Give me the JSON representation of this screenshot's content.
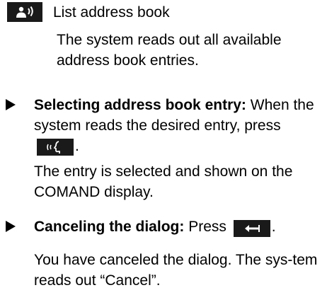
{
  "command": {
    "icon": "voice-command-person-icon",
    "label": "List address book",
    "description": "The system reads out all available address book entries."
  },
  "steps": [
    {
      "title": "Selecting address book entry:",
      "text_before": "When the system reads the desired entry, press",
      "icon": "talk-button-icon",
      "text_after": ".",
      "result": "The entry is selected and shown on the COMAND display."
    },
    {
      "title": "Canceling the dialog:",
      "text_before": "Press",
      "icon": "back-button-icon",
      "text_after": ".",
      "result": "You have canceled the dialog. The sys-tem reads out “Cancel”."
    }
  ]
}
